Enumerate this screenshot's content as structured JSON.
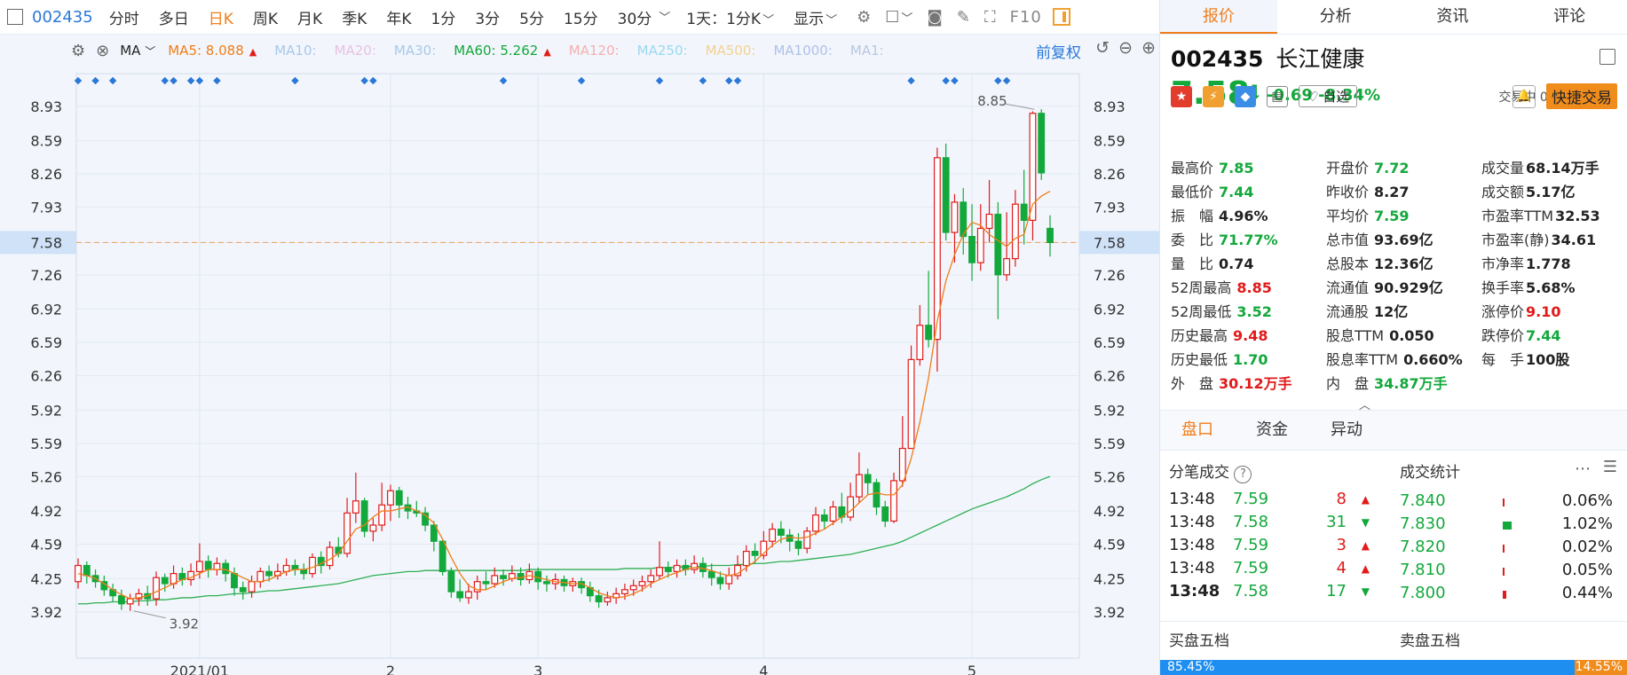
{
  "toolbar": {
    "code": "002435",
    "periods": [
      "分时",
      "多日",
      "日K",
      "周K",
      "月K",
      "季K",
      "年K",
      "1分",
      "3分",
      "5分",
      "15分",
      "30分"
    ],
    "active_period": "日K",
    "option1": "1天：1分K",
    "option2": "显示",
    "f10": "F10"
  },
  "ma_bar": {
    "label": "MA",
    "items": [
      {
        "text": "MA5: 8.088",
        "color": "#f07d1a",
        "arrow": "▲"
      },
      {
        "text": "MA10:",
        "color": "#a8c8ea",
        "arrow": ""
      },
      {
        "text": "MA20:",
        "color": "#e8c0e0",
        "arrow": ""
      },
      {
        "text": "MA30:",
        "color": "#a8c8ea",
        "arrow": ""
      },
      {
        "text": "MA60: 5.262",
        "color": "#13a83b",
        "arrow": "▲"
      },
      {
        "text": "MA120:",
        "color": "#f4b0b0",
        "arrow": ""
      },
      {
        "text": "MA250:",
        "color": "#9ad8f0",
        "arrow": ""
      },
      {
        "text": "MA500:",
        "color": "#f4d090",
        "arrow": ""
      },
      {
        "text": "MA1000:",
        "color": "#b0c0e8",
        "arrow": ""
      },
      {
        "text": "MA1:",
        "color": "#b8c8e0",
        "arrow": ""
      }
    ],
    "fuquan": "前复权"
  },
  "chart_data": {
    "type": "candlestick",
    "current_price": 7.58,
    "yticks": [
      8.93,
      8.59,
      8.26,
      7.93,
      7.58,
      7.26,
      6.92,
      6.59,
      6.26,
      5.92,
      5.59,
      5.26,
      4.92,
      4.59,
      4.25,
      3.92
    ],
    "ylim": [
      3.62,
      9.06
    ],
    "xlabels": [
      {
        "label": "2021/01",
        "i": 14
      },
      {
        "label": "2",
        "i": 36
      },
      {
        "label": "3",
        "i": 53
      },
      {
        "label": "4",
        "i": 79
      },
      {
        "label": "5",
        "i": 103
      }
    ],
    "high_label": "8.85",
    "low_label": "3.92",
    "candles": [
      [
        4.22,
        4.38,
        4.45,
        4.15
      ],
      [
        4.38,
        4.28,
        4.42,
        4.2
      ],
      [
        4.28,
        4.22,
        4.34,
        4.16
      ],
      [
        4.22,
        4.14,
        4.28,
        4.08
      ],
      [
        4.14,
        4.08,
        4.2,
        4.02
      ],
      [
        4.08,
        4.0,
        4.14,
        3.94
      ],
      [
        4.0,
        4.05,
        4.1,
        3.93
      ],
      [
        4.05,
        4.1,
        4.15,
        3.98
      ],
      [
        4.1,
        4.05,
        4.18,
        3.98
      ],
      [
        4.05,
        4.26,
        4.32,
        3.98
      ],
      [
        4.26,
        4.2,
        4.3,
        4.12
      ],
      [
        4.2,
        4.3,
        4.38,
        4.15
      ],
      [
        4.3,
        4.24,
        4.36,
        4.18
      ],
      [
        4.24,
        4.32,
        4.4,
        4.18
      ],
      [
        4.32,
        4.42,
        4.6,
        4.25
      ],
      [
        4.42,
        4.34,
        4.48,
        4.26
      ],
      [
        4.34,
        4.4,
        4.46,
        4.28
      ],
      [
        4.4,
        4.3,
        4.44,
        4.22
      ],
      [
        4.3,
        4.16,
        4.36,
        4.08
      ],
      [
        4.16,
        4.12,
        4.22,
        4.04
      ],
      [
        4.12,
        4.22,
        4.28,
        4.06
      ],
      [
        4.22,
        4.32,
        4.36,
        4.16
      ],
      [
        4.32,
        4.28,
        4.38,
        4.22
      ],
      [
        4.28,
        4.32,
        4.4,
        4.24
      ],
      [
        4.32,
        4.38,
        4.45,
        4.28
      ],
      [
        4.38,
        4.34,
        4.44,
        4.28
      ],
      [
        4.34,
        4.3,
        4.4,
        4.24
      ],
      [
        4.3,
        4.46,
        4.5,
        4.26
      ],
      [
        4.46,
        4.38,
        4.52,
        4.3
      ],
      [
        4.38,
        4.56,
        4.62,
        4.34
      ],
      [
        4.56,
        4.5,
        4.66,
        4.46
      ],
      [
        4.5,
        4.9,
        5.05,
        4.46
      ],
      [
        4.9,
        5.02,
        5.3,
        4.8
      ],
      [
        5.02,
        4.72,
        5.05,
        4.66
      ],
      [
        4.72,
        4.78,
        4.85,
        4.62
      ],
      [
        4.78,
        4.98,
        5.2,
        4.72
      ],
      [
        4.98,
        5.12,
        5.18,
        4.82
      ],
      [
        5.12,
        4.98,
        5.16,
        4.85
      ],
      [
        4.98,
        4.92,
        5.06,
        4.84
      ],
      [
        4.92,
        4.9,
        5.02,
        4.86
      ],
      [
        4.9,
        4.78,
        4.96,
        4.72
      ],
      [
        4.78,
        4.62,
        4.82,
        4.52
      ],
      [
        4.62,
        4.32,
        4.64,
        4.28
      ],
      [
        4.32,
        4.12,
        4.36,
        4.06
      ],
      [
        4.12,
        4.06,
        4.24,
        4.02
      ],
      [
        4.06,
        4.12,
        4.2,
        4.0
      ],
      [
        4.12,
        4.22,
        4.28,
        4.04
      ],
      [
        4.22,
        4.2,
        4.32,
        4.14
      ],
      [
        4.2,
        4.28,
        4.36,
        4.16
      ],
      [
        4.28,
        4.25,
        4.34,
        4.18
      ],
      [
        4.25,
        4.3,
        4.38,
        4.22
      ],
      [
        4.3,
        4.24,
        4.36,
        4.18
      ],
      [
        4.24,
        4.32,
        4.4,
        4.2
      ],
      [
        4.32,
        4.22,
        4.36,
        4.14
      ],
      [
        4.22,
        4.2,
        4.28,
        4.12
      ],
      [
        4.2,
        4.24,
        4.3,
        4.14
      ],
      [
        4.24,
        4.18,
        4.28,
        4.12
      ],
      [
        4.18,
        4.22,
        4.26,
        4.12
      ],
      [
        4.22,
        4.16,
        4.26,
        4.1
      ],
      [
        4.16,
        4.08,
        4.22,
        4.02
      ],
      [
        4.08,
        4.02,
        4.14,
        3.96
      ],
      [
        4.02,
        4.06,
        4.12,
        3.98
      ],
      [
        4.06,
        4.1,
        4.16,
        4.0
      ],
      [
        4.1,
        4.14,
        4.2,
        4.04
      ],
      [
        4.14,
        4.18,
        4.24,
        4.08
      ],
      [
        4.18,
        4.22,
        4.28,
        4.12
      ],
      [
        4.22,
        4.28,
        4.34,
        4.16
      ],
      [
        4.28,
        4.36,
        4.62,
        4.24
      ],
      [
        4.36,
        4.32,
        4.42,
        4.26
      ],
      [
        4.32,
        4.38,
        4.44,
        4.26
      ],
      [
        4.38,
        4.34,
        4.44,
        4.28
      ],
      [
        4.34,
        4.4,
        4.48,
        4.3
      ],
      [
        4.4,
        4.32,
        4.46,
        4.26
      ],
      [
        4.32,
        4.26,
        4.4,
        4.18
      ],
      [
        4.26,
        4.2,
        4.32,
        4.14
      ],
      [
        4.2,
        4.28,
        4.36,
        4.14
      ],
      [
        4.28,
        4.38,
        4.48,
        4.24
      ],
      [
        4.38,
        4.52,
        4.58,
        4.32
      ],
      [
        4.52,
        4.48,
        4.6,
        4.4
      ],
      [
        4.48,
        4.62,
        4.72,
        4.44
      ],
      [
        4.62,
        4.74,
        4.8,
        4.56
      ],
      [
        4.74,
        4.68,
        4.82,
        4.6
      ],
      [
        4.68,
        4.62,
        4.74,
        4.52
      ],
      [
        4.62,
        4.55,
        4.7,
        4.48
      ],
      [
        4.55,
        4.72,
        4.76,
        4.5
      ],
      [
        4.72,
        4.88,
        4.96,
        4.68
      ],
      [
        4.88,
        4.82,
        4.94,
        4.74
      ],
      [
        4.82,
        4.96,
        5.02,
        4.78
      ],
      [
        4.96,
        4.86,
        5.1,
        4.8
      ],
      [
        4.86,
        5.06,
        5.2,
        4.82
      ],
      [
        5.06,
        5.28,
        5.5,
        5.0
      ],
      [
        5.28,
        5.2,
        5.34,
        5.08
      ],
      [
        5.2,
        4.96,
        5.24,
        4.88
      ],
      [
        4.96,
        4.82,
        5.02,
        4.76
      ],
      [
        4.82,
        5.22,
        5.3,
        4.8
      ],
      [
        5.22,
        5.54,
        5.86,
        5.16
      ],
      [
        5.54,
        6.42,
        6.56,
        6.26
      ],
      [
        6.42,
        6.76,
        6.96,
        6.36
      ],
      [
        6.76,
        6.62,
        7.3,
        6.54
      ],
      [
        6.62,
        8.42,
        8.52,
        6.3
      ],
      [
        8.42,
        7.68,
        8.56,
        7.6
      ],
      [
        7.68,
        7.98,
        8.06,
        7.38
      ],
      [
        7.98,
        7.64,
        8.12,
        7.46
      ],
      [
        7.64,
        7.38,
        7.96,
        7.2
      ],
      [
        7.38,
        7.72,
        7.96,
        7.3
      ],
      [
        7.72,
        7.86,
        8.2,
        7.58
      ],
      [
        7.86,
        7.26,
        7.98,
        6.82
      ],
      [
        7.26,
        7.42,
        7.88,
        7.2
      ],
      [
        7.42,
        7.96,
        8.1,
        7.34
      ],
      [
        7.96,
        7.8,
        8.3,
        7.56
      ],
      [
        7.8,
        8.86,
        8.88,
        7.6
      ],
      [
        8.86,
        8.27,
        8.9,
        8.2
      ],
      [
        7.72,
        7.58,
        7.85,
        7.44
      ]
    ],
    "ma5": [
      4.3,
      4.28,
      4.25,
      4.2,
      4.14,
      4.09,
      4.05,
      4.06,
      4.08,
      4.12,
      4.16,
      4.2,
      4.24,
      4.26,
      4.3,
      4.34,
      4.34,
      4.34,
      4.3,
      4.26,
      4.22,
      4.22,
      4.24,
      4.28,
      4.32,
      4.34,
      4.34,
      4.36,
      4.4,
      4.44,
      4.5,
      4.62,
      4.74,
      4.78,
      4.86,
      4.92,
      4.92,
      4.94,
      4.96,
      4.92,
      4.88,
      4.8,
      4.64,
      4.46,
      4.3,
      4.18,
      4.14,
      4.14,
      4.18,
      4.22,
      4.25,
      4.26,
      4.28,
      4.26,
      4.24,
      4.22,
      4.21,
      4.2,
      4.2,
      4.16,
      4.11,
      4.08,
      4.06,
      4.07,
      4.1,
      4.14,
      4.2,
      4.24,
      4.28,
      4.31,
      4.34,
      4.36,
      4.35,
      4.33,
      4.3,
      4.28,
      4.3,
      4.36,
      4.42,
      4.5,
      4.58,
      4.64,
      4.66,
      4.65,
      4.66,
      4.7,
      4.74,
      4.8,
      4.86,
      4.92,
      5.0,
      5.08,
      5.1,
      5.08,
      5.08,
      5.18,
      5.44,
      5.8,
      6.24,
      6.8,
      7.2,
      7.46,
      7.66,
      7.78,
      7.75,
      7.66,
      7.6,
      7.54,
      7.62,
      7.66,
      7.96,
      8.04,
      8.088
    ],
    "ma60": [
      4.0,
      4.0,
      4.01,
      4.01,
      4.02,
      4.02,
      4.02,
      4.03,
      4.03,
      4.04,
      4.04,
      4.05,
      4.06,
      4.06,
      4.07,
      4.08,
      4.08,
      4.09,
      4.1,
      4.1,
      4.11,
      4.12,
      4.13,
      4.13,
      4.14,
      4.15,
      4.16,
      4.17,
      4.18,
      4.19,
      4.2,
      4.22,
      4.24,
      4.26,
      4.28,
      4.29,
      4.3,
      4.31,
      4.32,
      4.32,
      4.33,
      4.33,
      4.33,
      4.33,
      4.33,
      4.33,
      4.33,
      4.33,
      4.33,
      4.33,
      4.33,
      4.33,
      4.34,
      4.34,
      4.34,
      4.34,
      4.34,
      4.34,
      4.34,
      4.34,
      4.34,
      4.34,
      4.34,
      4.35,
      4.35,
      4.35,
      4.35,
      4.36,
      4.36,
      4.36,
      4.37,
      4.37,
      4.37,
      4.38,
      4.38,
      4.38,
      4.39,
      4.39,
      4.4,
      4.4,
      4.41,
      4.42,
      4.42,
      4.43,
      4.44,
      4.45,
      4.46,
      4.47,
      4.48,
      4.49,
      4.51,
      4.53,
      4.55,
      4.57,
      4.59,
      4.62,
      4.66,
      4.7,
      4.74,
      4.78,
      4.82,
      4.86,
      4.9,
      4.94,
      4.97,
      5.0,
      5.03,
      5.06,
      5.1,
      5.14,
      5.19,
      5.23,
      5.262
    ]
  },
  "panel": {
    "tabs": [
      "报价",
      "分析",
      "资讯",
      "评论"
    ],
    "code": "002435",
    "name": "长江健康",
    "price": "7.58",
    "change": "-0.69",
    "change_pct": "-8.34%",
    "trade_status": "交易中 05/17 13:48",
    "zixuan": "自选",
    "fast_trade": "快捷交易",
    "stats": [
      [
        {
          "k": "最高价",
          "v": "7.85",
          "c": "green"
        },
        {
          "k": "开盘价",
          "v": "7.72",
          "c": "green"
        },
        {
          "k": "成交量",
          "v": "68.14万手",
          "c": "blk"
        }
      ],
      [
        {
          "k": "最低价",
          "v": "7.44",
          "c": "green"
        },
        {
          "k": "昨收价",
          "v": "8.27",
          "c": "blk"
        },
        {
          "k": "成交额",
          "v": "5.17亿",
          "c": "blk"
        }
      ],
      [
        {
          "k": "振　幅",
          "v": "4.96%",
          "c": "blk"
        },
        {
          "k": "平均价",
          "v": "7.59",
          "c": "green"
        },
        {
          "k": "市盈率TTM",
          "v": "32.53",
          "c": "blk"
        }
      ],
      [
        {
          "k": "委　比",
          "v": "71.77%",
          "c": "green"
        },
        {
          "k": "总市值",
          "v": "93.69亿",
          "c": "blk"
        },
        {
          "k": "市盈率(静)",
          "v": "34.61",
          "c": "blk"
        }
      ],
      [
        {
          "k": "量　比",
          "v": "0.74",
          "c": "blk"
        },
        {
          "k": "总股本",
          "v": "12.36亿",
          "c": "blk"
        },
        {
          "k": "市净率",
          "v": "1.778",
          "c": "blk"
        }
      ],
      [
        {
          "k": "52周最高",
          "v": "8.85",
          "c": "red"
        },
        {
          "k": "流通值",
          "v": "90.929亿",
          "c": "blk"
        },
        {
          "k": "换手率",
          "v": "5.68%",
          "c": "blk"
        }
      ],
      [
        {
          "k": "52周最低",
          "v": "3.52",
          "c": "green"
        },
        {
          "k": "流通股",
          "v": "12亿",
          "c": "blk"
        },
        {
          "k": "涨停价",
          "v": "9.10",
          "c": "red"
        }
      ],
      [
        {
          "k": "历史最高",
          "v": "9.48",
          "c": "red"
        },
        {
          "k": "股息TTM",
          "v": "0.050",
          "c": "blk"
        },
        {
          "k": "跌停价",
          "v": "7.44",
          "c": "green"
        }
      ],
      [
        {
          "k": "历史最低",
          "v": "1.70",
          "c": "green"
        },
        {
          "k": "股息率TTM",
          "v": "0.660%",
          "c": "blk"
        },
        {
          "k": "每　手",
          "v": "100股",
          "c": "blk"
        }
      ],
      [
        {
          "k": "外　盘",
          "v": "30.12万手",
          "c": "red"
        },
        {
          "k": "内　盘",
          "v": "34.87万手",
          "c": "green"
        },
        {
          "k": "",
          "v": "",
          "c": "blk"
        }
      ]
    ],
    "subtabs": [
      "盘口",
      "资金",
      "异动"
    ],
    "deals_title": "分笔成交",
    "stats_title": "成交统计",
    "deals": [
      {
        "t": "13:48",
        "p": "7.59",
        "v": "8",
        "d": "up"
      },
      {
        "t": "13:48",
        "p": "7.58",
        "v": "31",
        "d": "down"
      },
      {
        "t": "13:48",
        "p": "7.59",
        "v": "3",
        "d": "up"
      },
      {
        "t": "13:48",
        "p": "7.59",
        "v": "4",
        "d": "up"
      },
      {
        "t": "13:48",
        "p": "7.58",
        "v": "17",
        "d": "down"
      }
    ],
    "volstats": [
      {
        "p": "7.840",
        "pct": "0.06%",
        "w": 2,
        "c": "#e21a1a"
      },
      {
        "p": "7.830",
        "pct": "1.02%",
        "w": 10,
        "c": "#13a83b"
      },
      {
        "p": "7.820",
        "pct": "0.02%",
        "w": 2,
        "c": "#e21a1a"
      },
      {
        "p": "7.810",
        "pct": "0.05%",
        "w": 2,
        "c": "#e21a1a"
      },
      {
        "p": "7.800",
        "pct": "0.44%",
        "w": 4,
        "c": "#e21a1a"
      }
    ],
    "buy5": "买盘五档",
    "sell5": "卖盘五档",
    "buy_pct": "85.45%",
    "sell_pct": "14.55%"
  }
}
